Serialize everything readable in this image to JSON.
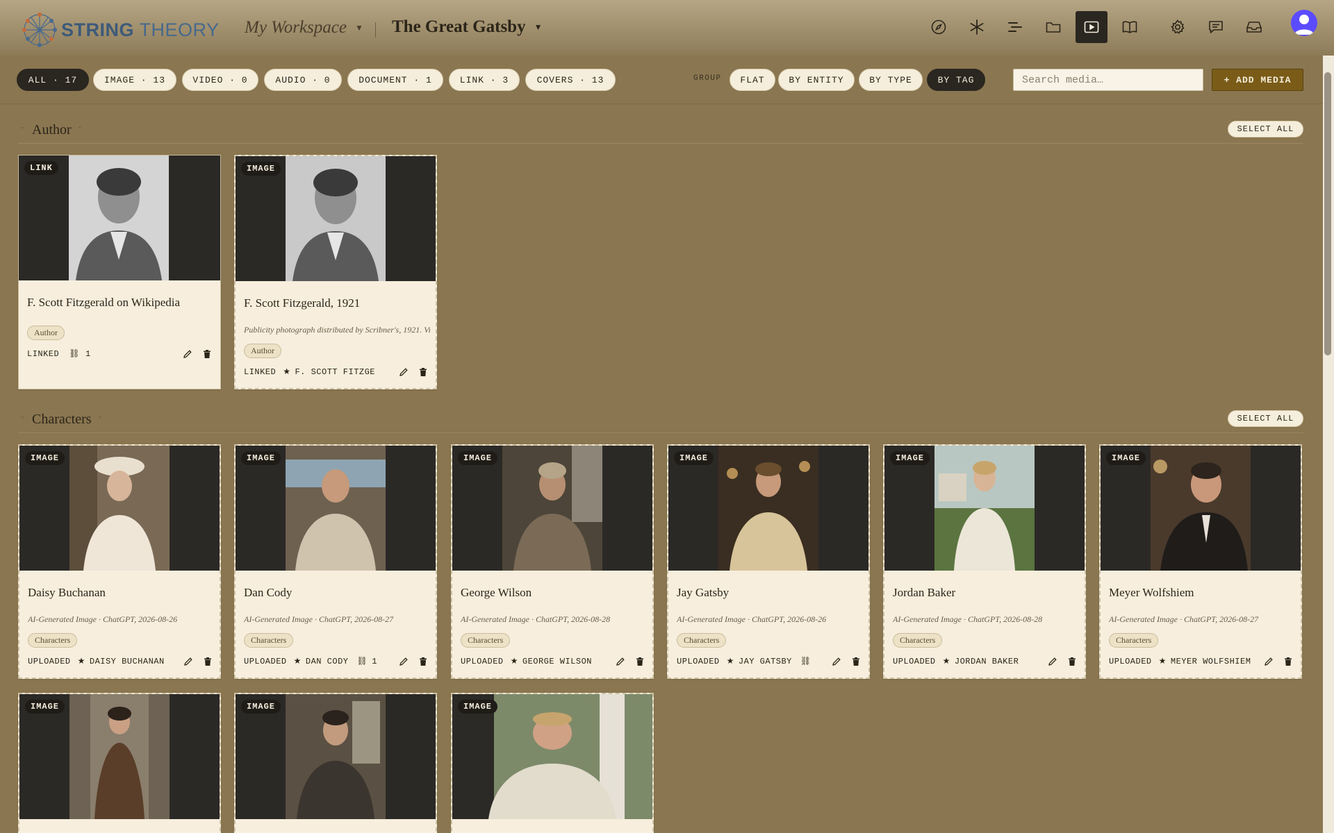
{
  "app": {
    "logo_a": "STRING",
    "logo_b": " THEORY"
  },
  "header": {
    "workspace": "My Workspace",
    "project": "The Great Gatsby",
    "nav_icons": [
      "compass-icon",
      "asterisk-icon",
      "outline-icon",
      "folder-icon",
      "media-icon",
      "book-icon",
      "gear-icon",
      "chat-icon",
      "inbox-icon"
    ],
    "active_icon": "media-icon"
  },
  "filters": {
    "type_pills": [
      {
        "label": "ALL · 17",
        "active": true
      },
      {
        "label": "IMAGE · 13",
        "active": false
      },
      {
        "label": "VIDEO · 0",
        "active": false
      },
      {
        "label": "AUDIO · 0",
        "active": false
      },
      {
        "label": "DOCUMENT · 1",
        "active": false
      },
      {
        "label": "LINK · 3",
        "active": false
      },
      {
        "label": "COVERS · 13",
        "active": false
      }
    ],
    "group_label": "GROUP",
    "group_pills": [
      {
        "label": "FLAT",
        "active": false
      },
      {
        "label": "BY ENTITY",
        "active": false
      },
      {
        "label": "BY TYPE",
        "active": false
      },
      {
        "label": "BY TAG",
        "active": true
      }
    ],
    "search_placeholder": "Search media…",
    "add_label": "+ ADD MEDIA"
  },
  "sections": [
    {
      "title": "Author",
      "select_all": "SELECT ALL",
      "cards": [
        {
          "badge": "LINK",
          "title": "F. Scott Fitzgerald on Wikipedia",
          "desc": "",
          "tag": "Author",
          "status": "LINKED",
          "entity": "",
          "link_count": "1"
        },
        {
          "badge": "IMAGE",
          "title": "F. Scott Fitzgerald, 1921",
          "desc": "Publicity photograph distributed by Scribner's, 1921. Vi…",
          "tag": "Author",
          "status": "LINKED",
          "entity": "F. SCOTT FITZGE",
          "link_count": ""
        }
      ]
    },
    {
      "title": "Characters",
      "select_all": "SELECT ALL",
      "cards": [
        {
          "badge": "IMAGE",
          "title": "Daisy Buchanan",
          "desc": "AI-Generated Image · ChatGPT, 2026-08-26",
          "tag": "Characters",
          "status": "UPLOADED",
          "entity": "DAISY BUCHANAN",
          "link_count": ""
        },
        {
          "badge": "IMAGE",
          "title": "Dan Cody",
          "desc": "AI-Generated Image · ChatGPT, 2026-08-27",
          "tag": "Characters",
          "status": "UPLOADED",
          "entity": "DAN CODY",
          "link_count": "1"
        },
        {
          "badge": "IMAGE",
          "title": "George Wilson",
          "desc": "AI-Generated Image · ChatGPT, 2026-08-28",
          "tag": "Characters",
          "status": "UPLOADED",
          "entity": "GEORGE WILSON",
          "link_count": ""
        },
        {
          "badge": "IMAGE",
          "title": "Jay Gatsby",
          "desc": "AI-Generated Image · ChatGPT, 2026-08-26",
          "tag": "Characters",
          "status": "UPLOADED",
          "entity": "JAY GATSBY",
          "link_count": ""
        },
        {
          "badge": "IMAGE",
          "title": "Jordan Baker",
          "desc": "AI-Generated Image · ChatGPT, 2026-08-28",
          "tag": "Characters",
          "status": "UPLOADED",
          "entity": "JORDAN BAKER",
          "link_count": ""
        },
        {
          "badge": "IMAGE",
          "title": "Meyer Wolfshiem",
          "desc": "AI-Generated Image · ChatGPT, 2026-08-27",
          "tag": "Characters",
          "status": "UPLOADED",
          "entity": "MEYER WOLFSHIEM",
          "link_count": ""
        },
        {
          "badge": "IMAGE"
        },
        {
          "badge": "IMAGE"
        },
        {
          "badge": "IMAGE"
        }
      ]
    }
  ]
}
